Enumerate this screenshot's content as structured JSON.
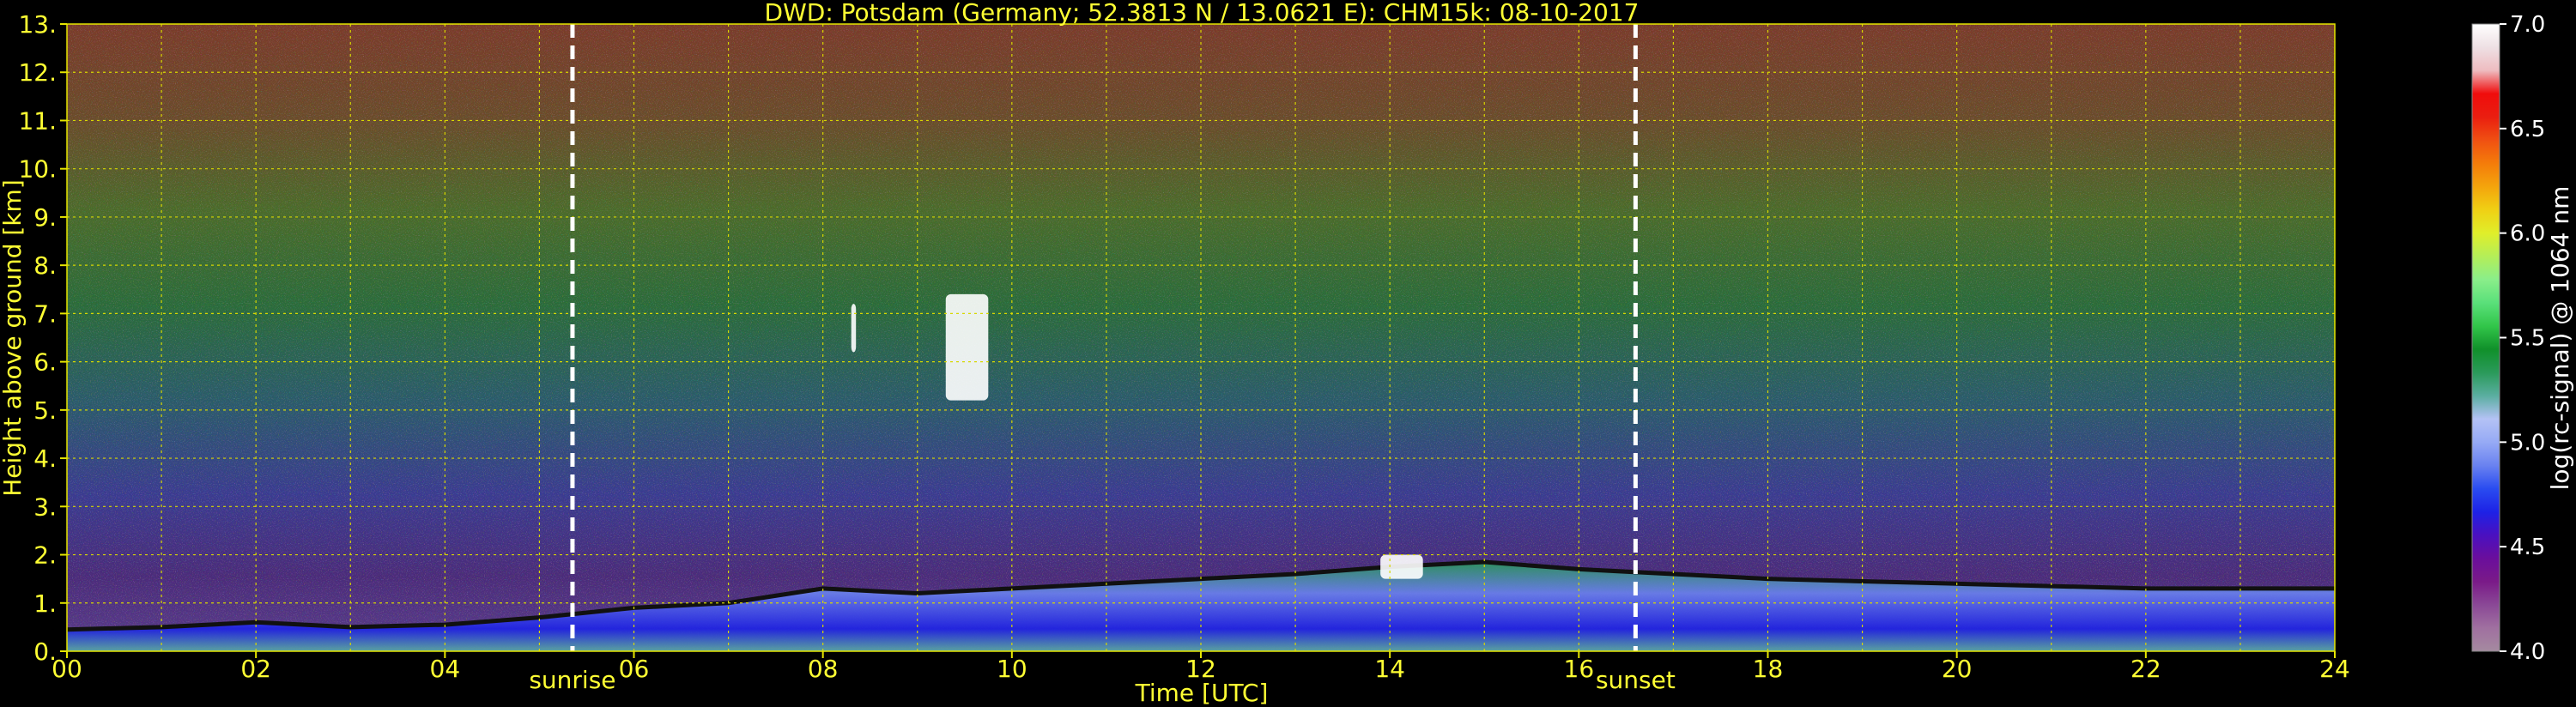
{
  "chart_data": {
    "type": "heatmap",
    "title": "DWD: Potsdam (Germany; 52.3813 N / 13.0621 E):    CHM15k: 08-10-2017",
    "xlabel": "Time [UTC]",
    "ylabel": "Height above ground [km]",
    "xlim": [
      0,
      24
    ],
    "ylim": [
      0,
      13
    ],
    "x_ticks": [
      "00",
      "02",
      "04",
      "06",
      "08",
      "10",
      "12",
      "14",
      "16",
      "18",
      "20",
      "22",
      "24"
    ],
    "y_ticks": [
      "0.",
      "1.",
      "2.",
      "3.",
      "4.",
      "5.",
      "6.",
      "7.",
      "8.",
      "9.",
      "10.",
      "11.",
      "12.",
      "13."
    ],
    "grid": true,
    "colorbar": {
      "label": "log(rc-signal) @ 1064 nm",
      "min": 4.0,
      "max": 7.0,
      "ticks": [
        "4.0",
        "4.5",
        "5.0",
        "5.5",
        "6.0",
        "6.5",
        "7.0"
      ],
      "colors": [
        "#a58aa0",
        "#a070a0",
        "#8a4896",
        "#7a1a88",
        "#6a0e9c",
        "#4a10c0",
        "#1d22e6",
        "#2a4cf0",
        "#6a82f0",
        "#96aaf5",
        "#b4c2f5",
        "#5aaea0",
        "#2a9a5a",
        "#10902a",
        "#32c64a",
        "#5ae07a",
        "#8aee8a",
        "#b4ee58",
        "#e0ee2a",
        "#f0d014",
        "#f4a40c",
        "#f47c0a",
        "#f05012",
        "#ea1e10",
        "#f00c0c",
        "#eebcc0",
        "#eee0e4",
        "#ffffff"
      ]
    },
    "annotations": [
      {
        "text": "sunrise",
        "x": 5.35
      },
      {
        "text": "sunset",
        "x": 16.6
      }
    ],
    "layers": {
      "aerosol_layer_top_km": [
        {
          "x": 0,
          "y": 0.45
        },
        {
          "x": 1,
          "y": 0.5
        },
        {
          "x": 2,
          "y": 0.6
        },
        {
          "x": 3,
          "y": 0.5
        },
        {
          "x": 4,
          "y": 0.55
        },
        {
          "x": 5,
          "y": 0.7
        },
        {
          "x": 6,
          "y": 0.9
        },
        {
          "x": 7,
          "y": 1.0
        },
        {
          "x": 8,
          "y": 1.3
        },
        {
          "x": 9,
          "y": 1.2
        },
        {
          "x": 10,
          "y": 1.3
        },
        {
          "x": 11,
          "y": 1.4
        },
        {
          "x": 12,
          "y": 1.5
        },
        {
          "x": 13,
          "y": 1.6
        },
        {
          "x": 14,
          "y": 1.75
        },
        {
          "x": 15,
          "y": 1.85
        },
        {
          "x": 16,
          "y": 1.7
        },
        {
          "x": 17,
          "y": 1.6
        },
        {
          "x": 18,
          "y": 1.5
        },
        {
          "x": 19,
          "y": 1.45
        },
        {
          "x": 20,
          "y": 1.4
        },
        {
          "x": 21,
          "y": 1.35
        },
        {
          "x": 22,
          "y": 1.3
        },
        {
          "x": 23,
          "y": 1.3
        },
        {
          "x": 24,
          "y": 1.3
        }
      ],
      "clouds": [
        {
          "x_start": 9.3,
          "x_end": 9.75,
          "y_start": 5.2,
          "y_end": 7.4
        },
        {
          "x_start": 8.3,
          "x_end": 8.35,
          "y_start": 6.2,
          "y_end": 7.2
        },
        {
          "x_start": 13.9,
          "x_end": 14.35,
          "y_start": 1.5,
          "y_end": 2.0
        }
      ]
    }
  }
}
